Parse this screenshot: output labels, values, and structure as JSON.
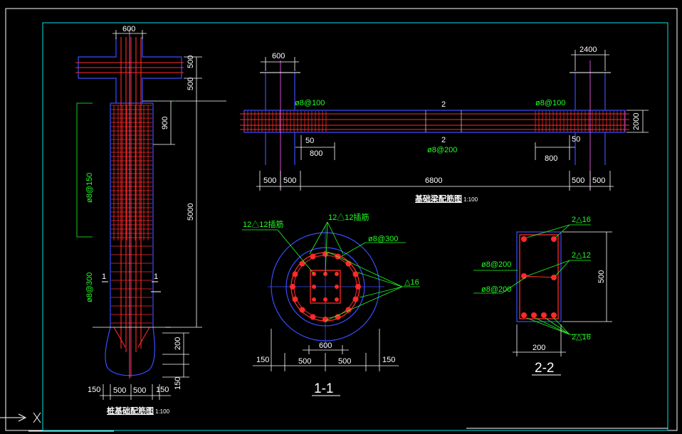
{
  "colors": {
    "background": "#000000",
    "frame": "#00e5e5",
    "outline": "#3a4dff",
    "rebar": "#ff2a2a",
    "leader": "#22ff22",
    "dimension": "#ffffff"
  },
  "pile": {
    "top_dim": "600",
    "right_dims": [
      "500",
      "500",
      "900",
      "5000"
    ],
    "left_rebar_1": "ø8@150",
    "left_rebar_2": "ø8@300",
    "section_mark": "1",
    "base_right_dims": [
      "200",
      "150"
    ],
    "bottom_dims": [
      "150",
      "500",
      "500",
      "150"
    ],
    "title": "桩基础配筋图",
    "scale": "1:100"
  },
  "beam": {
    "top_left_dim": "600",
    "top_right_dim": "2400",
    "right_dim": "2000",
    "stirrup_left": "ø8@100",
    "stirrup_right": "ø8@100",
    "stirrup_mid": "ø8@200",
    "mark_top": "2",
    "mark_bottom": "2",
    "dim_50_left": "50",
    "dim_50_right": "50",
    "dim_800_left": "800",
    "dim_800_right": "800",
    "bottom_dims": [
      "500",
      "500",
      "6800",
      "500",
      "500"
    ],
    "title": "基础梁配筋图",
    "scale": "1:100"
  },
  "section_1": {
    "dowel_left": "12△12插筋",
    "dowel_top": "12△12插筋",
    "stirrup": "ø8@300",
    "main_bar": "△16",
    "dim_600": "600",
    "bottom_dims": [
      "150",
      "500",
      "500",
      "150"
    ],
    "label": "1-1"
  },
  "section_2": {
    "top_bars": "2△16",
    "mid_bars": "2△12",
    "stirrup_1": "ø8@200",
    "stirrup_2": "ø8@200",
    "bottom_bars": "2△16",
    "height_dim": "500",
    "width_dim": "200",
    "label": "2-2"
  }
}
